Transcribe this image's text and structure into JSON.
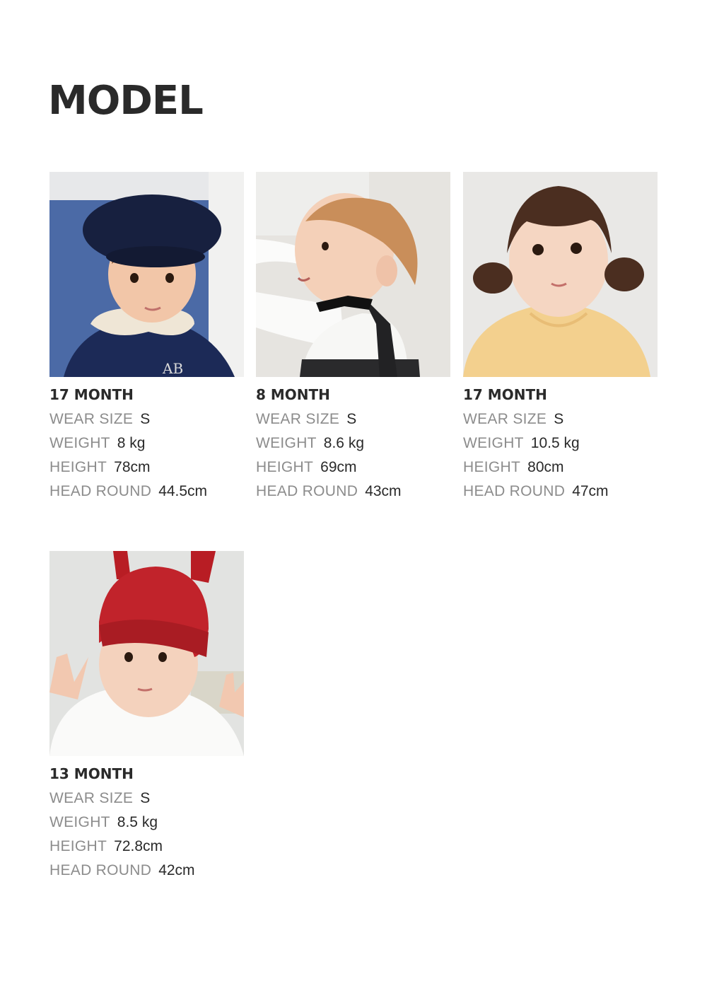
{
  "heading": "MODEL",
  "models": [
    {
      "age": "17 MONTH",
      "photo": "baby-navy-beret",
      "labels": {
        "wear_size": "WEAR SIZE",
        "weight": "WEIGHT",
        "height": "HEIGHT",
        "head_round": "HEAD ROUND"
      },
      "values": {
        "wear_size": "S",
        "weight": "8 kg",
        "height": "78cm",
        "head_round": "44.5cm"
      }
    },
    {
      "age": "8 MONTH",
      "photo": "baby-white-top-black-bow",
      "labels": {
        "wear_size": "WEAR SIZE",
        "weight": "WEIGHT",
        "height": "HEIGHT",
        "head_round": "HEAD ROUND"
      },
      "values": {
        "wear_size": "S",
        "weight": "8.6 kg",
        "height": "69cm",
        "head_round": "43cm"
      }
    },
    {
      "age": "17 MONTH",
      "photo": "toddler-pigtails-yellow-top",
      "labels": {
        "wear_size": "WEAR SIZE",
        "weight": "WEIGHT",
        "height": "HEIGHT",
        "head_round": "HEAD ROUND"
      },
      "values": {
        "wear_size": "S",
        "weight": "10.5 kg",
        "height": "80cm",
        "head_round": "47cm"
      }
    },
    {
      "age": "13 MONTH",
      "photo": "baby-red-ear-beanie",
      "labels": {
        "wear_size": "WEAR SIZE",
        "weight": "WEIGHT",
        "height": "HEIGHT",
        "head_round": "HEAD ROUND"
      },
      "values": {
        "wear_size": "S",
        "weight": "8.5 kg",
        "height": "72.8cm",
        "head_round": "42cm"
      }
    }
  ]
}
